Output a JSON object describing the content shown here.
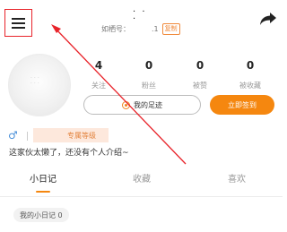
{
  "header": {
    "username": "· · ·",
    "id_prefix": "如栖号：",
    "id_suffix": ".1",
    "copy_label": "复制",
    "icons": {
      "menu": "hamburger-menu-icon",
      "share": "share-arrow-icon"
    }
  },
  "profile": {
    "stats": [
      {
        "value": "4",
        "label": "关注"
      },
      {
        "value": "0",
        "label": "粉丝"
      },
      {
        "value": "0",
        "label": "被赞"
      },
      {
        "value": "0",
        "label": "被收藏"
      }
    ],
    "footprint_label": "我的足迹",
    "checkin_label": "立即签到",
    "gender_symbol": "♂",
    "level_label": "专属等级",
    "bio": "这家伙太懒了，还没有个人介绍~"
  },
  "tabs": [
    {
      "label": "小日记",
      "active": true
    },
    {
      "label": "收藏",
      "active": false
    },
    {
      "label": "喜欢",
      "active": false
    }
  ],
  "diary": {
    "count_label": "我的小日记 0"
  },
  "colors": {
    "accent": "#f5870f",
    "annotation": "#e8232a",
    "gender": "#4a90d9"
  }
}
